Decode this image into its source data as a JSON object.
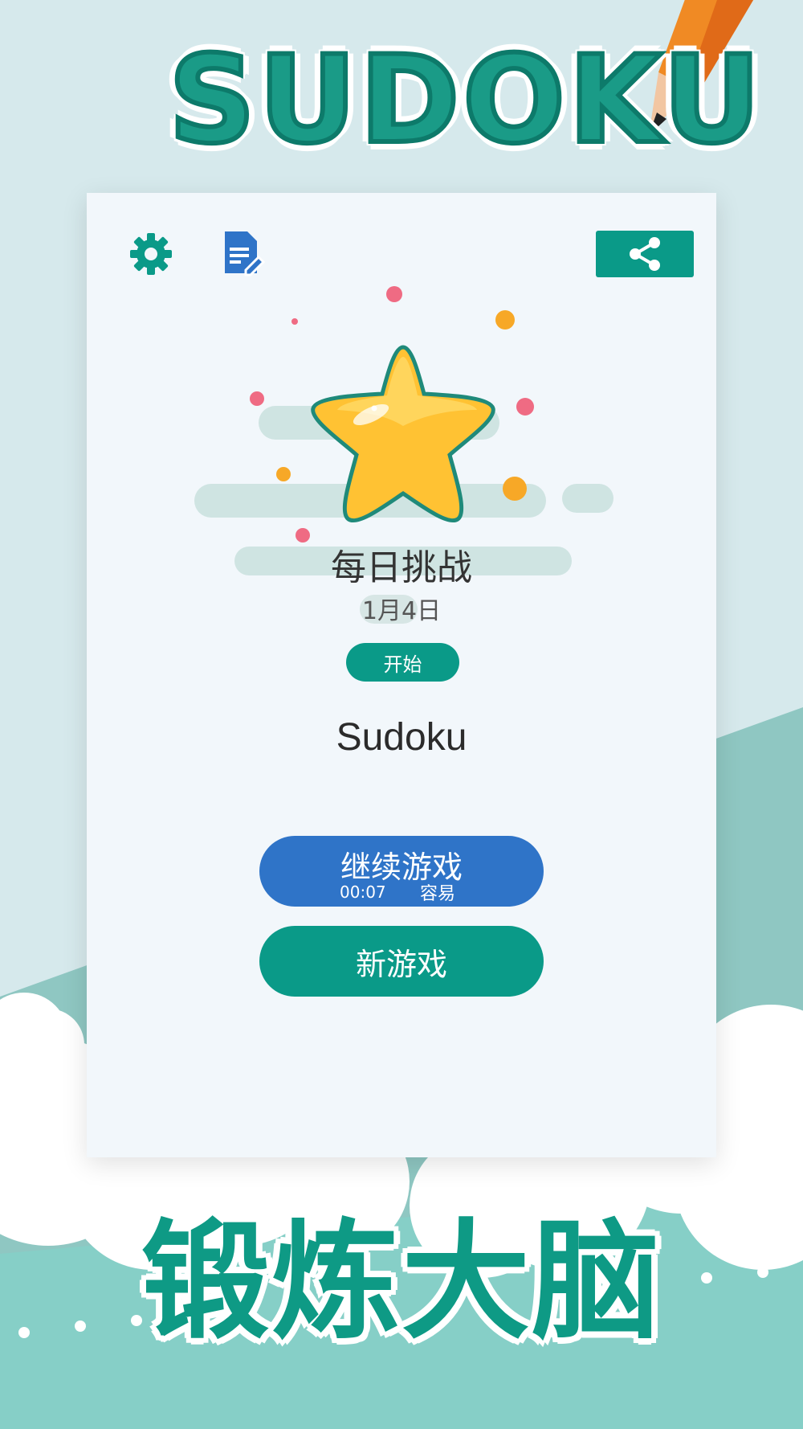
{
  "promo": {
    "top_title": "SUDOKU",
    "bottom_slogan": "锻炼大脑"
  },
  "app": {
    "name": "Sudoku",
    "icons": [
      "gear-icon",
      "notes-icon",
      "share-icon",
      "star-icon"
    ],
    "daily_challenge": {
      "title": "每日挑战",
      "date": "1月4日",
      "start_label": "开始"
    },
    "continue_game": {
      "label": "继续游戏",
      "time": "00:07",
      "difficulty": "容易"
    },
    "new_game_label": "新游戏"
  },
  "colors": {
    "accent_teal": "#0a9a88",
    "continue_blue": "#2f74c8",
    "card_bg": "#f2f7fb",
    "page_bg": "#d6e9ec",
    "hill_teal": "#8fcac5"
  }
}
